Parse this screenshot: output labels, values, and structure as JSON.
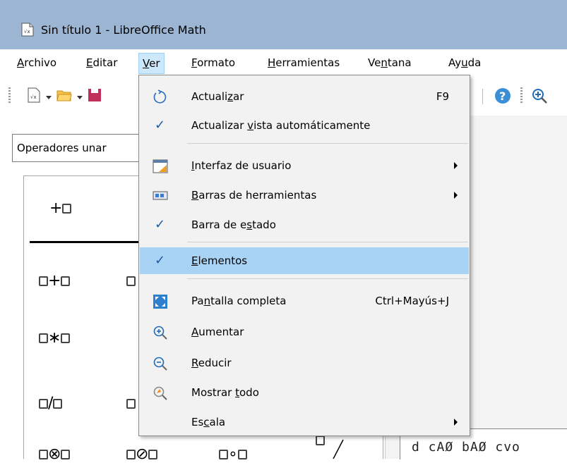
{
  "window": {
    "title": "Sin título 1 - LibreOffice Math"
  },
  "menubar": {
    "items": [
      {
        "label": "Archivo",
        "mnemonic": "A"
      },
      {
        "label": "Editar",
        "mnemonic": "E"
      },
      {
        "label": "Ver",
        "mnemonic": "V"
      },
      {
        "label": "Formato",
        "mnemonic": "F"
      },
      {
        "label": "Herramientas",
        "mnemonic": "H"
      },
      {
        "label": "Ventana",
        "mnemonic": "n"
      },
      {
        "label": "Ayuda",
        "mnemonic": "u"
      }
    ]
  },
  "elements": {
    "category": "Operadores unar",
    "symbols": [
      "+",
      "+",
      "∗",
      "/",
      "⊗",
      "⊘",
      "∘"
    ]
  },
  "document": {
    "visible_text": "d cAØ bAØ cvo"
  },
  "view_menu": {
    "items": [
      {
        "label": "Actualizar",
        "mnemonic": "z",
        "shortcut": "F9",
        "icon": "refresh-icon"
      },
      {
        "label": "Actualizar vista automáticamente",
        "mnemonic": "v",
        "checked": true
      },
      {
        "label": "Interfaz de usuario",
        "mnemonic": "I",
        "submenu": true,
        "icon": "user-interface-icon"
      },
      {
        "label": "Barras de herramientas",
        "mnemonic": "B",
        "submenu": true,
        "icon": "toolbars-icon"
      },
      {
        "label": "Barra de estado",
        "mnemonic": "s",
        "checked": true
      },
      {
        "label": "Elementos",
        "mnemonic": "E",
        "checked": true,
        "highlighted": true
      },
      {
        "label": "Pantalla completa",
        "mnemonic": "n",
        "shortcut": "Ctrl+Mayús+J",
        "icon": "fullscreen-icon"
      },
      {
        "label": "Aumentar",
        "mnemonic": "A",
        "icon": "zoom-in-icon"
      },
      {
        "label": "Reducir",
        "mnemonic": "R",
        "icon": "zoom-out-icon"
      },
      {
        "label": "Mostrar todo",
        "mnemonic": "t",
        "icon": "show-all-icon"
      },
      {
        "label": "Escala",
        "mnemonic": "c",
        "submenu": true
      }
    ]
  },
  "colors": {
    "titlebar": "#9cb5d3",
    "menu_highlight": "#a8d3f5",
    "check": "#1e5aa8"
  }
}
